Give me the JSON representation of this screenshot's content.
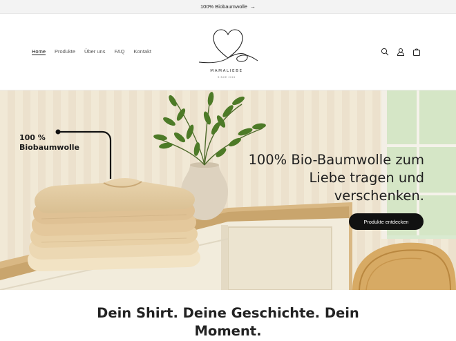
{
  "announcement": {
    "text": "100% Biobaumwolle",
    "arrow": "→"
  },
  "nav": {
    "items": [
      {
        "label": "Home",
        "active": true
      },
      {
        "label": "Produkte",
        "active": false
      },
      {
        "label": "Über uns",
        "active": false
      },
      {
        "label": "FAQ",
        "active": false
      },
      {
        "label": "Kontakt",
        "active": false
      }
    ]
  },
  "logo": {
    "brand": "MAMALIEBE",
    "since": "SINCE 2024"
  },
  "header_icons": [
    "search-icon",
    "account-icon",
    "cart-icon"
  ],
  "hero": {
    "badge_line1": "100 %",
    "badge_line2": "Biobaumwolle",
    "title": "100% Bio-Baumwolle zum Liebe tragen und verschenken.",
    "cta_label": "Produkte entdecken"
  },
  "tagline": "Dein Shirt. Deine Geschichte. Dein Moment.",
  "colors": {
    "cta_bg": "#111111",
    "announcement_bg": "#f3f3f3",
    "hero_bg": "#ede4cf"
  }
}
